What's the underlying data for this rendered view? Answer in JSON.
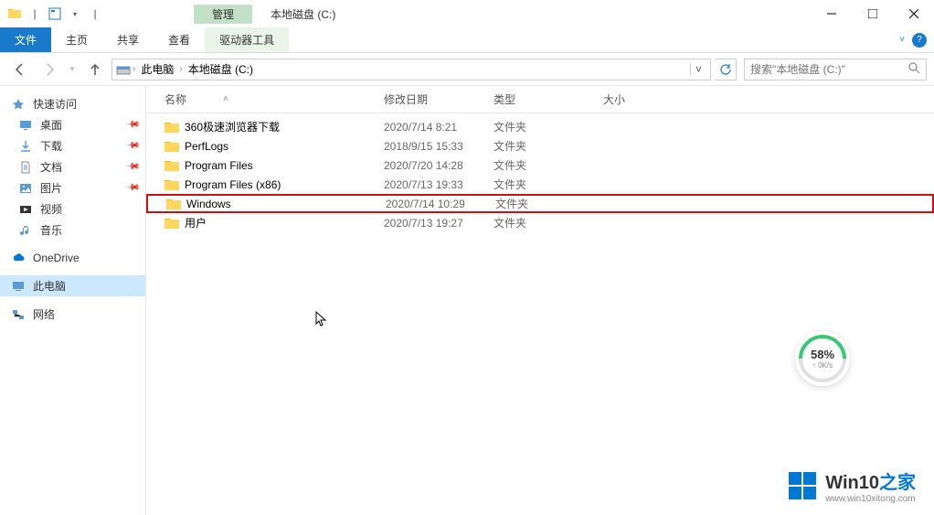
{
  "titlebar": {
    "context_tab": "管理",
    "title": "本地磁盘 (C:)"
  },
  "ribbon": {
    "file": "文件",
    "home": "主页",
    "share": "共享",
    "view": "查看",
    "drive_tools": "驱动器工具"
  },
  "breadcrumb": {
    "pc": "此电脑",
    "drive": "本地磁盘 (C:)"
  },
  "search": {
    "placeholder": "搜索\"本地磁盘 (C:)\""
  },
  "sidebar": {
    "quick_access": "快速访问",
    "desktop": "桌面",
    "downloads": "下载",
    "documents": "文档",
    "pictures": "图片",
    "videos": "视频",
    "music": "音乐",
    "onedrive": "OneDrive",
    "this_pc": "此电脑",
    "network": "网络"
  },
  "columns": {
    "name": "名称",
    "date": "修改日期",
    "type": "类型",
    "size": "大小"
  },
  "files": [
    {
      "name": "360极速浏览器下载",
      "date": "2020/7/14 8:21",
      "type": "文件夹",
      "highlighted": false
    },
    {
      "name": "PerfLogs",
      "date": "2018/9/15 15:33",
      "type": "文件夹",
      "highlighted": false
    },
    {
      "name": "Program Files",
      "date": "2020/7/20 14:28",
      "type": "文件夹",
      "highlighted": false
    },
    {
      "name": "Program Files (x86)",
      "date": "2020/7/13 19:33",
      "type": "文件夹",
      "highlighted": false
    },
    {
      "name": "Windows",
      "date": "2020/7/14 10:29",
      "type": "文件夹",
      "highlighted": true
    },
    {
      "name": "用户",
      "date": "2020/7/13 19:27",
      "type": "文件夹",
      "highlighted": false
    }
  ],
  "speed_widget": {
    "percent": "58%",
    "rate": "↑ 0K/s"
  },
  "watermark": {
    "title_a": "Win10",
    "title_b": "之家",
    "url": "www.win10xitong.com"
  }
}
